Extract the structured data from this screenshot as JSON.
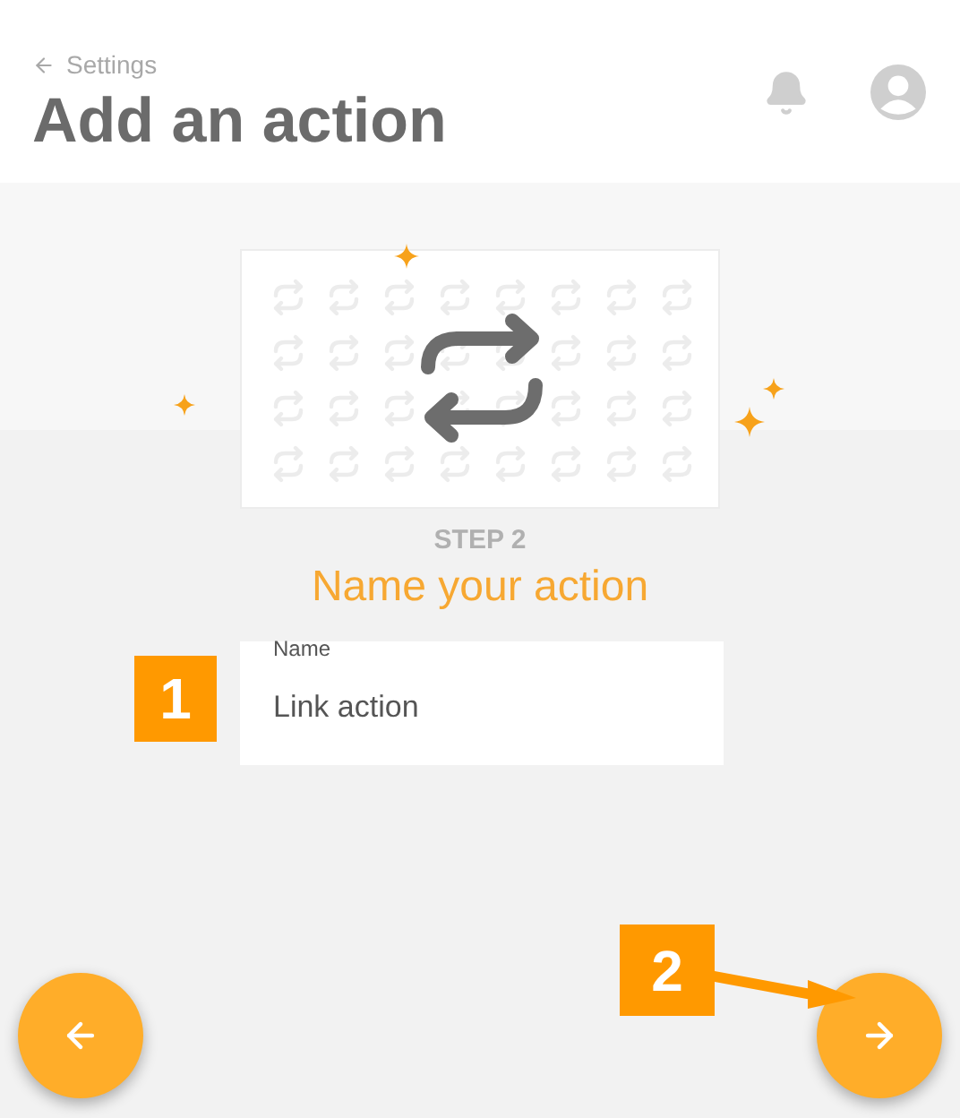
{
  "header": {
    "back_link": "Settings",
    "title": "Add an action"
  },
  "step": {
    "label": "STEP 2",
    "heading": "Name your action"
  },
  "field": {
    "label": "Name",
    "value": "Link action"
  },
  "annotations": [
    {
      "label": "1"
    },
    {
      "label": "2"
    }
  ],
  "navigation": [
    {
      "kind": "back"
    },
    {
      "kind": "next"
    }
  ]
}
